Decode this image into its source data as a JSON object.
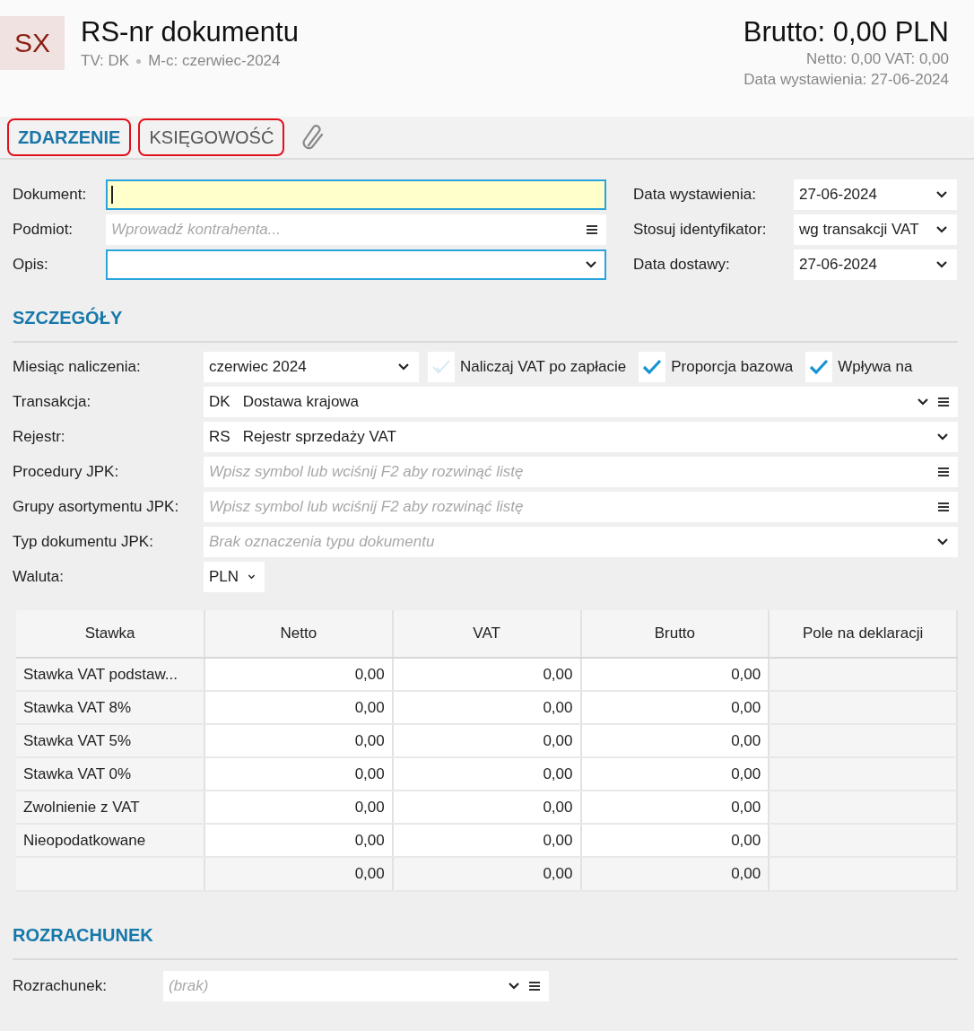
{
  "header": {
    "logo": "SX",
    "title": "RS-nr dokumentu",
    "meta": [
      "TV: DK",
      "M-c: czerwiec-2024"
    ],
    "gross": "Brutto: 0,00 PLN",
    "net_vat": "Netto: 0,00 VAT: 0,00",
    "issue_date": "Data wystawienia: 27-06-2024"
  },
  "tabs": [
    {
      "label": "ZDARZENIE",
      "selected": true
    },
    {
      "label": "KSIĘGOWOŚĆ",
      "selected": false
    }
  ],
  "main_fields_left": [
    {
      "label": "Dokument:",
      "kind": "text",
      "required": true,
      "highlighted": true
    },
    {
      "label": "Podmiot:",
      "kind": "lookup",
      "placeholder": "Wprowadź kontrahenta...",
      "required": false,
      "highlighted": false
    },
    {
      "label": "Opis:",
      "kind": "combo",
      "required": false,
      "highlighted": true
    }
  ],
  "main_fields_right": [
    {
      "label": "Data wystawienia:",
      "kind": "combo",
      "value": "27-06-2024"
    },
    {
      "label": "Stosuj identyfikator:",
      "kind": "combo",
      "value": "wg transakcji VAT"
    },
    {
      "label": "Data dostawy:",
      "kind": "combo",
      "value": "27-06-2024"
    }
  ],
  "details": {
    "title": "SZCZEGÓŁY",
    "month": {
      "label": "Miesiąc naliczenia:",
      "value": "czerwiec 2024"
    },
    "checkboxes": [
      {
        "label": "Naliczaj VAT po zapłacie",
        "checked": false
      },
      {
        "label": "Proporcja bazowa",
        "checked": true
      },
      {
        "label": "Wpływa na",
        "checked": true
      }
    ],
    "fields": [
      {
        "label": "Transakcja:",
        "kind": "combo-lookup",
        "code": "DK",
        "value": "Dostawa krajowa"
      },
      {
        "label": "Rejestr:",
        "kind": "combo",
        "code": "RS",
        "value": "Rejestr sprzedaży VAT"
      },
      {
        "label": "Procedury JPK:",
        "kind": "lookup",
        "placeholder": "Wpisz symbol lub wciśnij F2 aby rozwinąć listę"
      },
      {
        "label": "Grupy asortymentu JPK:",
        "kind": "lookup",
        "placeholder": "Wpisz symbol lub wciśnij F2 aby rozwinąć listę"
      },
      {
        "label": "Typ dokumentu JPK:",
        "kind": "combo",
        "placeholder": "Brak oznaczenia typu dokumentu"
      },
      {
        "label": "Waluta:",
        "kind": "small-combo",
        "value": "PLN"
      }
    ]
  },
  "vat_table": {
    "columns": [
      "Stawka",
      "Netto",
      "VAT",
      "Brutto",
      "Pole na deklaracji"
    ],
    "rows": [
      {
        "rate": "Stawka VAT podstaw...",
        "net": "0,00",
        "vat": "0,00",
        "gross": "0,00"
      },
      {
        "rate": "Stawka VAT 8%",
        "net": "0,00",
        "vat": "0,00",
        "gross": "0,00"
      },
      {
        "rate": "Stawka VAT 5%",
        "net": "0,00",
        "vat": "0,00",
        "gross": "0,00"
      },
      {
        "rate": "Stawka VAT 0%",
        "net": "0,00",
        "vat": "0,00",
        "gross": "0,00"
      },
      {
        "rate": "Zwolnienie z VAT",
        "net": "0,00",
        "vat": "0,00",
        "gross": "0,00"
      },
      {
        "rate": "Nieopodatkowane",
        "net": "0,00",
        "vat": "0,00",
        "gross": "0,00"
      }
    ],
    "totals": {
      "net": "0,00",
      "vat": "0,00",
      "gross": "0,00"
    }
  },
  "settlement": {
    "title": "ROZRACHUNEK",
    "label": "Rozrachunek:",
    "placeholder": "(brak)"
  }
}
